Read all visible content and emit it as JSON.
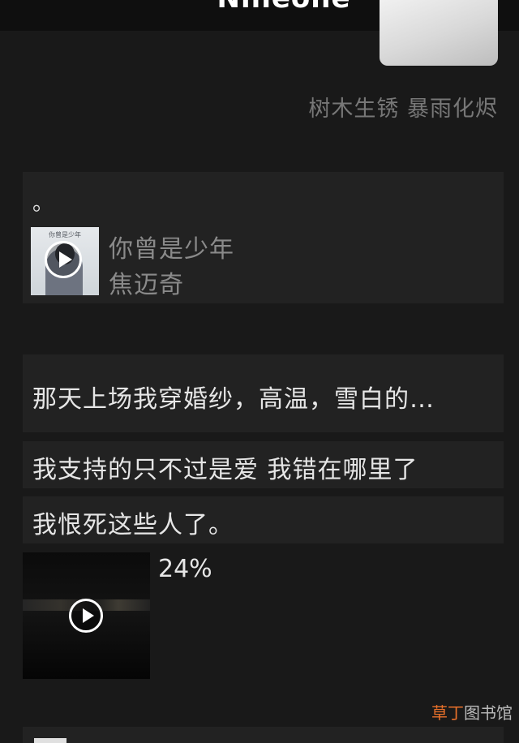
{
  "header": {
    "title": "Nineone"
  },
  "profile": {
    "signature": "树木生锈 暴雨化烬"
  },
  "music_post": {
    "caption": "。",
    "song_title": "你曾是少年",
    "artist": "焦迈奇",
    "cover_title": "你曾是少年"
  },
  "messages": [
    {
      "text": "那天上场我穿婚纱，高温，雪白的…"
    },
    {
      "text": "我支持的只不过是爱 我错在哪里了"
    },
    {
      "text": "我恨死这些人了。"
    }
  ],
  "video": {
    "progress": "24%"
  },
  "watermark": {
    "part1": "草丁",
    "part2": "图书馆"
  }
}
